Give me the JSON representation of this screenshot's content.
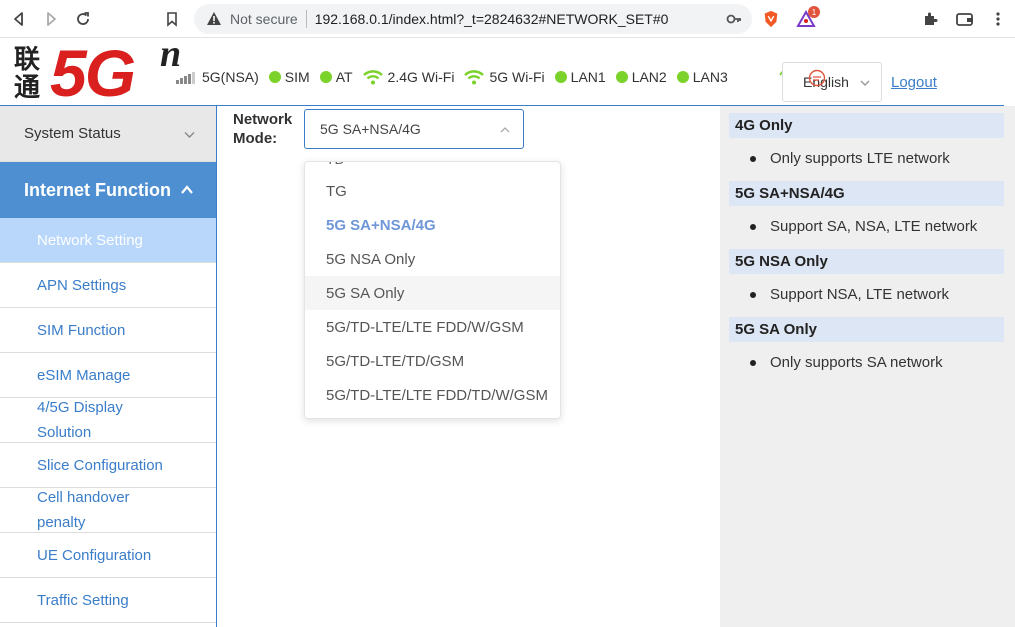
{
  "browser": {
    "security_text": "Not secure",
    "url": "192.168.0.1/index.html?_t=2824632#NETWORK_SET#0",
    "badge_count": "1"
  },
  "header": {
    "logo_cn": "联通",
    "logo_5g": "5G",
    "logo_n": "n",
    "status": [
      {
        "label": "5G(NSA)",
        "icon": "signal-bars-icon"
      },
      {
        "label": "SIM",
        "icon": "green-dot"
      },
      {
        "label": "AT",
        "icon": "green-dot"
      },
      {
        "label": "2.4G Wi-Fi",
        "icon": "wifi-icon"
      },
      {
        "label": "5G Wi-Fi",
        "icon": "wifi-icon"
      },
      {
        "label": "LAN1",
        "icon": "green-dot"
      },
      {
        "label": "LAN2",
        "icon": "green-dot"
      },
      {
        "label": "LAN3",
        "icon": "green-dot"
      }
    ],
    "language": "English",
    "logout": "Logout",
    "status_color": "#7bd22a"
  },
  "sidebar": {
    "system_status": "System Status",
    "section": "Internet Function",
    "items": [
      {
        "label": "Network Setting"
      },
      {
        "label": "APN Settings"
      },
      {
        "label": "SIM Function"
      },
      {
        "label": "eSIM Manage"
      },
      {
        "label": "4/5G Display",
        "label2": "Solution"
      },
      {
        "label": "Slice Configuration"
      },
      {
        "label": "Cell handover",
        "label2": "penalty"
      },
      {
        "label": "UE Configuration"
      },
      {
        "label": "Traffic Setting"
      }
    ]
  },
  "main": {
    "mode_label_1": "Network",
    "mode_label_2": "Mode:",
    "mode_value": "5G SA+NSA/4G",
    "options": [
      "TG",
      "5G SA+NSA/4G",
      "5G NSA Only",
      "5G SA Only",
      "5G/TD-LTE/LTE FDD/W/GSM",
      "5G/TD-LTE/TD/GSM",
      "5G/TD-LTE/LTE FDD/TD/W/GSM"
    ],
    "option_cut": "TD"
  },
  "help": [
    {
      "title": "4G Only",
      "desc": "Only supports LTE network"
    },
    {
      "title": "5G SA+NSA/4G",
      "desc": "Support SA, NSA, LTE network"
    },
    {
      "title": "5G NSA Only",
      "desc": "Support NSA, LTE network"
    },
    {
      "title": "5G SA Only",
      "desc": "Only supports SA network"
    }
  ],
  "colors": {
    "accent": "#3a7dc9",
    "brand_red": "#d9201f",
    "sidebar_active_bg": "#4e8fd2",
    "selected_option": "#6e97d8"
  }
}
